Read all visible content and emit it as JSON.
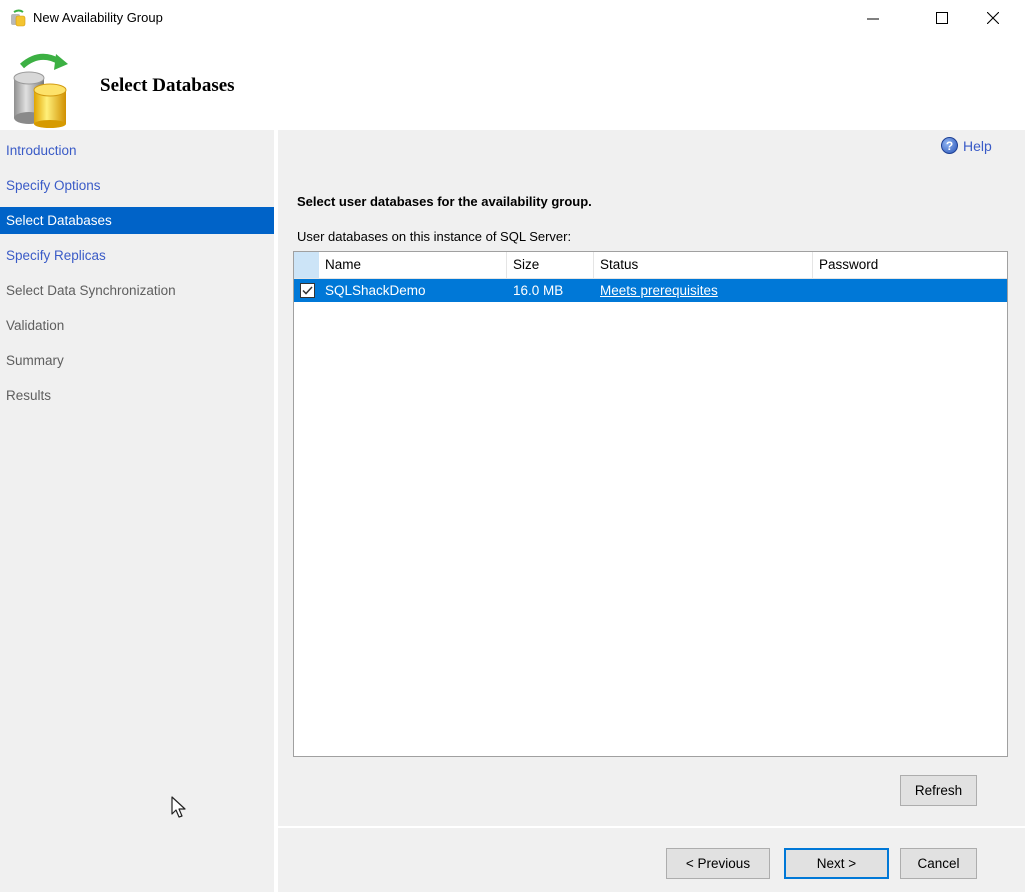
{
  "window": {
    "title": "New Availability Group",
    "controls": {
      "minimize": "minimize",
      "maximize": "maximize",
      "close": "close"
    }
  },
  "header": {
    "page_title": "Select Databases",
    "icon": "database-sync-icon"
  },
  "sidebar": {
    "items": [
      {
        "label": "Introduction",
        "state": "link"
      },
      {
        "label": "Specify Options",
        "state": "link"
      },
      {
        "label": "Select Databases",
        "state": "active"
      },
      {
        "label": "Specify Replicas",
        "state": "link"
      },
      {
        "label": "Select Data Synchronization",
        "state": "disabled"
      },
      {
        "label": "Validation",
        "state": "disabled"
      },
      {
        "label": "Summary",
        "state": "disabled"
      },
      {
        "label": "Results",
        "state": "disabled"
      }
    ]
  },
  "main": {
    "help_label": "Help",
    "instruction": "Select user databases for the availability group.",
    "list_label": "User databases on this instance of SQL Server:",
    "grid": {
      "columns": [
        "Name",
        "Size",
        "Status",
        "Password"
      ],
      "rows": [
        {
          "checked": true,
          "name": "SQLShackDemo",
          "size": "16.0 MB",
          "status": "Meets prerequisites",
          "password": ""
        }
      ]
    },
    "refresh_label": "Refresh"
  },
  "footer": {
    "previous_label": "< Previous",
    "next_label": "Next >",
    "cancel_label": "Cancel"
  },
  "colors": {
    "accent": "#0078d7",
    "nav_active": "#0063c8",
    "link": "#3a5bc7",
    "panel_bg": "#f0f0f0"
  }
}
